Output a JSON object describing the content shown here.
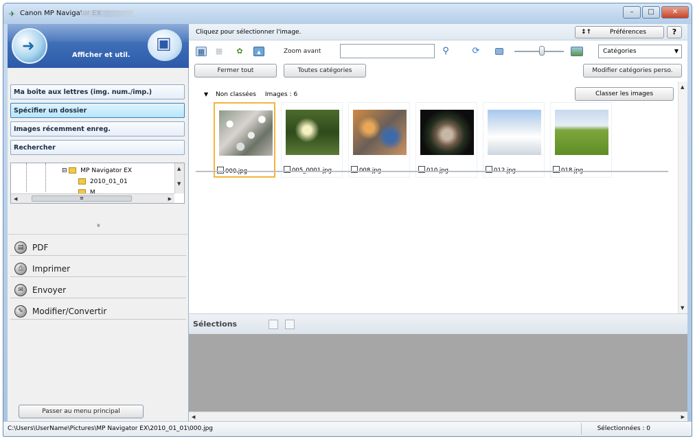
{
  "window": {
    "title": "Canon MP Navigator EX",
    "controls": [
      "–",
      "□",
      "✕"
    ]
  },
  "left_panel": {
    "mode_title": "Afficher et util.",
    "nav_items": [
      "Ma boîte aux lettres (img. num./imp.)",
      "Spécifier un dossier",
      "Images récemment enreg.",
      "Rechercher"
    ],
    "active_nav_index": 1,
    "tree": {
      "parent_folder": "MP Navigator EX",
      "child_folder": "2010_01_01",
      "partial_item": "M..."
    },
    "collapse_glyph": "»",
    "actions": [
      {
        "label": "PDF",
        "icon": "pdf-icon"
      },
      {
        "label": "Imprimer",
        "icon": "print-icon"
      },
      {
        "label": "Envoyer",
        "icon": "mail-icon"
      },
      {
        "label": "Modifier/Convertir",
        "icon": "edit-icon"
      }
    ],
    "main_menu_button": "Passer au menu principal"
  },
  "right_panel": {
    "instruction": "Cliquez pour sélectionner l'image.",
    "preferences_button": "Préférences",
    "preferences_icon": "↕↑",
    "help_button": "?",
    "zoom_label": "Zoom avant",
    "search_value": "",
    "category_select": "Catégories",
    "close_all_button": "Fermer tout",
    "all_categories_button": "Toutes catégories",
    "modify_categories_button": "Modifier catégories perso.",
    "group": {
      "name": "Non classées",
      "count_label": "Images : 6",
      "sort_button": "Classer les images"
    },
    "images": [
      {
        "name": "000.jpg",
        "selected": true
      },
      {
        "name": "005_0001.jpg",
        "selected": false
      },
      {
        "name": "008.jpg",
        "selected": false
      },
      {
        "name": "010.jpg",
        "selected": false
      },
      {
        "name": "012.jpg",
        "selected": false
      },
      {
        "name": "018.jpg",
        "selected": false
      }
    ],
    "selections_label": "Sélections"
  },
  "status": {
    "path": "C:\\Users\\UserName\\Pictures\\MP Navigator EX\\2010_01_01\\000.jpg",
    "selected_count": "Sélectionnées : 0"
  },
  "colors": {
    "selection_highlight": "#f3b43a",
    "mode_header": "#2c5aa8",
    "active_nav": "#b6e6fa"
  }
}
